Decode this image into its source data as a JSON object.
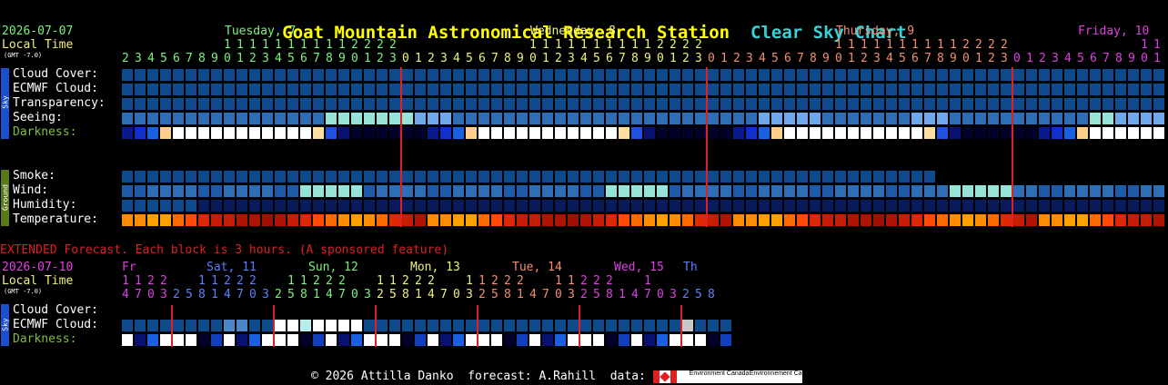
{
  "title": {
    "station": "Goat Mountain Astronomical Research Station",
    "chart": "Clear Sky Chart"
  },
  "main": {
    "date": "2026-07-07",
    "local_time": "Local Time",
    "gmt": "(GMT -7.0)",
    "days": [
      {
        "label": "Tuesday, 7",
        "color": "#7ff07f"
      },
      {
        "label": "Wednesday, 8",
        "color": "#f0f07f"
      },
      {
        "label": "Thursday, 9",
        "color": "#f08f6f"
      },
      {
        "label": "Friday, 10",
        "color": "#e040e0"
      }
    ],
    "hours_tens": "1 1 1 1 1 1 1 1 1 1 1 2 2 2 2",
    "hours_start": 2,
    "hours_count": 72,
    "sky_rows": [
      {
        "label": "Cloud Cover:",
        "cells": "BBBBBBBBBBBBBBBBBBBBBBBBBBBBBBBBBBBBBBBBBBBBBBBBBBBBBBBBBBBBBBBBBBBBBBBBBBBBBBBBBBBBBBBBBBBBBBBBBBBBBBB"
      },
      {
        "label": "ECMWF Cloud:",
        "cells": "BBBBBBBBBBBBBBBBBBBBBBBBBBBBBBBBBBBBBBBBBBBBBBBBBBBBBBBBBBBBBBBBBBBBBBBBBBBBBBBBBBBBBBBBBBBBBBBBBBBBBBB"
      },
      {
        "label": "Transparency:",
        "cells": "BBBBBBBBBBBBBBBBBBBBBBBBBBBBBBBBBBBBBBBBBBBBBBBBBBBBBBBBBBBBBBBBBBBBBBBBBBBBBBBBBBBBBBBBBBBBBBBBBBBBBBB"
      },
      {
        "label": "Seeing:",
        "cells": "mmmmmmmmmmmmmmmmcccccccpppmmmmmmmmmmmmmmmmmmmmmmmmpppppmmmmmmmpppmmmmmmmmmmmccpppppmmmmmppmmmmmmmmmmmm"
      },
      {
        "label": "Darkness:",
        "cells": "darkness"
      }
    ],
    "ground_rows": [
      {
        "label": "Smoke:"
      },
      {
        "label": "Wind:"
      },
      {
        "label": "Humidity:"
      },
      {
        "label": "Temperature:"
      }
    ],
    "sky_tag": "Sky",
    "ground_tag": "Ground"
  },
  "extended": {
    "note": "EXTENDED Forecast. Each block is 3 hours. (A sponsored feature)",
    "date": "2026-07-10",
    "local_time": "Local Time",
    "gmt": "(GMT -7.0)",
    "days": [
      {
        "label": "Fr",
        "color": "#e040e0"
      },
      {
        "label": "Sat, 11",
        "color": "#5f7fff"
      },
      {
        "label": "Sun, 12",
        "color": "#7ff07f"
      },
      {
        "label": "Mon, 13",
        "color": "#f0f07f"
      },
      {
        "label": "Tue, 14",
        "color": "#f08f6f"
      },
      {
        "label": "Wed, 15",
        "color": "#e040e0"
      },
      {
        "label": "Th",
        "color": "#5f7fff"
      }
    ],
    "rows": [
      {
        "label": "Cloud Cover:"
      },
      {
        "label": "ECMWF Cloud:"
      },
      {
        "label": "Darkness:"
      }
    ],
    "sky_tag": "Sky"
  },
  "footer": {
    "text": "© 2026 Attilla Danko  forecast: A.Rahill  data:",
    "brand1": "Environment Canada",
    "brand2": "Environnement Canada"
  },
  "colors": {
    "accent_title": "#ffff00",
    "accent_chart": "#3bd0d8",
    "label_darkness": "#7fbf3f",
    "extended_note": "#e02020",
    "day_line": "#e02020"
  }
}
